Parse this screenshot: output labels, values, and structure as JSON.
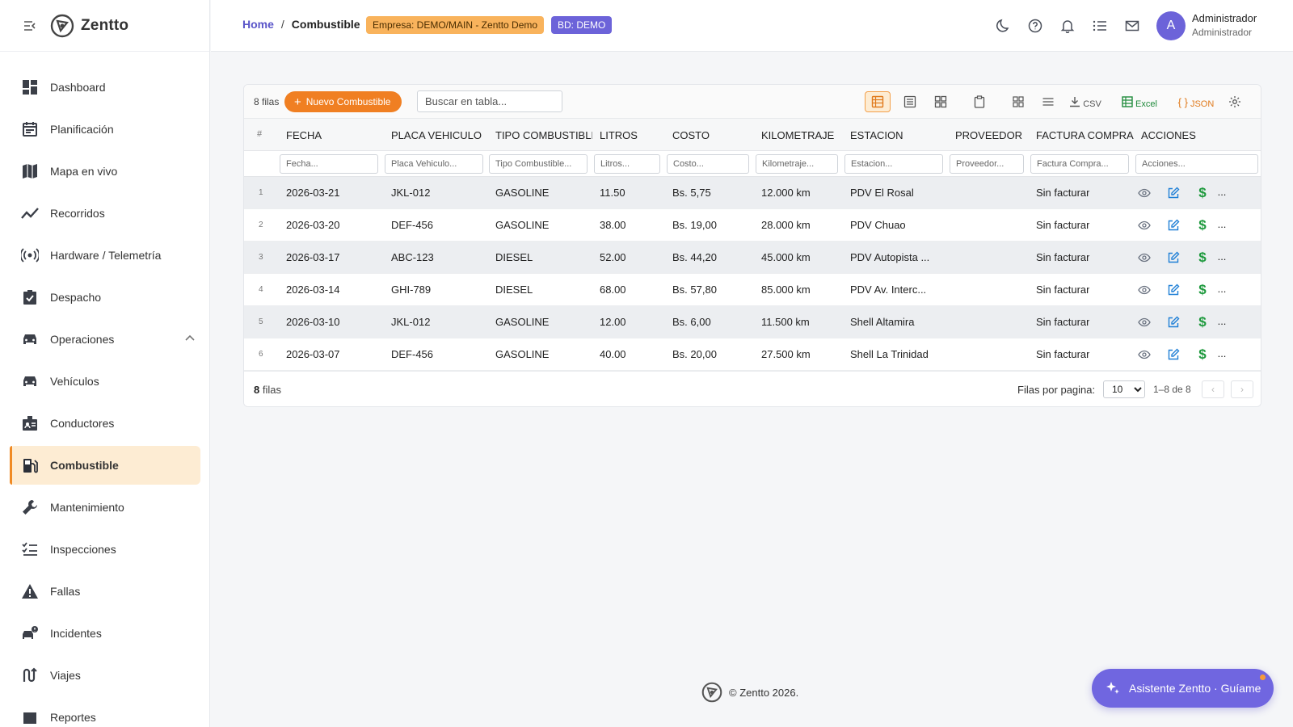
{
  "brand": {
    "name": "Zentto"
  },
  "sidebar": {
    "items": [
      {
        "label": "Dashboard",
        "icon": "dashboard-icon"
      },
      {
        "label": "Planificación",
        "icon": "calendar-icon"
      },
      {
        "label": "Mapa en vivo",
        "icon": "map-icon"
      },
      {
        "label": "Recorridos",
        "icon": "route-chart-icon"
      },
      {
        "label": "Hardware / Telemetría",
        "icon": "broadcast-icon"
      },
      {
        "label": "Despacho",
        "icon": "clipboard-check-icon"
      },
      {
        "label": "Operaciones",
        "icon": "car-icon"
      },
      {
        "label": "Vehículos",
        "icon": "car-icon"
      },
      {
        "label": "Conductores",
        "icon": "id-badge-icon"
      },
      {
        "label": "Combustible",
        "icon": "fuel-icon",
        "active": true
      },
      {
        "label": "Mantenimiento",
        "icon": "wrench-icon"
      },
      {
        "label": "Inspecciones",
        "icon": "checklist-icon"
      },
      {
        "label": "Fallas",
        "icon": "warning-icon"
      },
      {
        "label": "Incidentes",
        "icon": "incident-car-icon"
      },
      {
        "label": "Viajes",
        "icon": "trips-icon"
      },
      {
        "label": "Reportes",
        "icon": "reports-icon"
      }
    ]
  },
  "header": {
    "breadcrumb_home": "Home",
    "breadcrumb_sep": "/",
    "breadcrumb_current": "Combustible",
    "org_badge": "Empresa: DEMO/MAIN - Zentto Demo",
    "db_badge": "BD: DEMO",
    "user_initial": "A",
    "user_name": "Administrador",
    "user_role": "Administrador"
  },
  "table": {
    "rows_label": "8 filas",
    "new_button": "Nuevo Combustible",
    "search_placeholder": "Buscar en tabla...",
    "export_csv": "CSV",
    "export_excel": "Excel",
    "export_json": "JSON",
    "columns": [
      "#",
      "FECHA",
      "PLACA VEHICULO",
      "TIPO COMBUSTIBLE",
      "LITROS",
      "COSTO",
      "KILOMETRAJE",
      "ESTACION",
      "PROVEEDOR",
      "FACTURA COMPRA",
      "ACCIONES"
    ],
    "filter_placeholders": [
      "Fecha...",
      "Placa Vehiculo...",
      "Tipo Combustible...",
      "Litros...",
      "Costo...",
      "Kilometraje...",
      "Estacion...",
      "Proveedor...",
      "Factura Compra...",
      "Acciones..."
    ],
    "rows": [
      {
        "n": "1",
        "fecha": "2026-03-21",
        "placa": "JKL-012",
        "tipo": "GASOLINE",
        "litros": "11.50",
        "costo": "Bs. 5,75",
        "km": "12.000 km",
        "estacion": "PDV El Rosal",
        "proveedor": "",
        "factura": "Sin facturar",
        "more": "..."
      },
      {
        "n": "2",
        "fecha": "2026-03-20",
        "placa": "DEF-456",
        "tipo": "GASOLINE",
        "litros": "38.00",
        "costo": "Bs. 19,00",
        "km": "28.000 km",
        "estacion": "PDV Chuao",
        "proveedor": "",
        "factura": "Sin facturar",
        "more": "..."
      },
      {
        "n": "3",
        "fecha": "2026-03-17",
        "placa": "ABC-123",
        "tipo": "DIESEL",
        "litros": "52.00",
        "costo": "Bs. 44,20",
        "km": "45.000 km",
        "estacion": "PDV Autopista ...",
        "proveedor": "",
        "factura": "Sin facturar",
        "more": "..."
      },
      {
        "n": "4",
        "fecha": "2026-03-14",
        "placa": "GHI-789",
        "tipo": "DIESEL",
        "litros": "68.00",
        "costo": "Bs. 57,80",
        "km": "85.000 km",
        "estacion": "PDV Av. Interc...",
        "proveedor": "",
        "factura": "Sin facturar",
        "more": "..."
      },
      {
        "n": "5",
        "fecha": "2026-03-10",
        "placa": "JKL-012",
        "tipo": "GASOLINE",
        "litros": "12.00",
        "costo": "Bs. 6,00",
        "km": "11.500 km",
        "estacion": "Shell Altamira",
        "proveedor": "",
        "factura": "Sin facturar",
        "more": "..."
      },
      {
        "n": "6",
        "fecha": "2026-03-07",
        "placa": "DEF-456",
        "tipo": "GASOLINE",
        "litros": "40.00",
        "costo": "Bs. 20,00",
        "km": "27.500 km",
        "estacion": "Shell La Trinidad",
        "proveedor": "",
        "factura": "Sin facturar",
        "more": "..."
      }
    ],
    "footer_count": "8",
    "footer_count_suffix": "filas",
    "rows_per_page_label": "Filas por pagina:",
    "rows_per_page": "10",
    "range": "1–8 de 8",
    "prev": "‹",
    "next": "›"
  },
  "footer": {
    "text": "© Zentto 2026."
  },
  "assistant": {
    "label": "Asistente Zentto · Guíame"
  },
  "colors": {
    "accent": "#f07f22",
    "primary": "#6c63d9",
    "active_bg": "#fdecd3"
  }
}
